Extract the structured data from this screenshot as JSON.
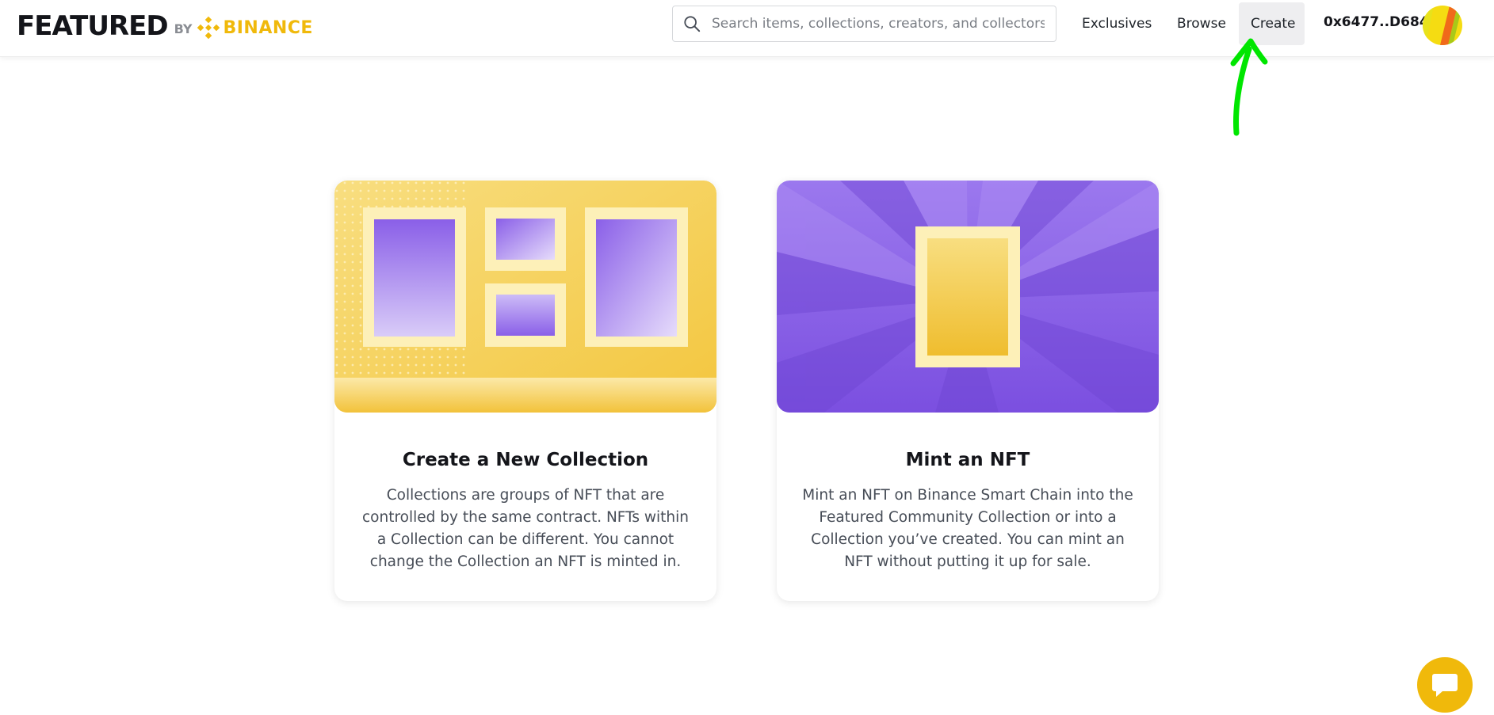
{
  "brand": {
    "name": "FEATURED",
    "by": "BY",
    "partner": "BINANCE",
    "accent_color": "#f0b90b"
  },
  "search": {
    "placeholder": "Search items, collections, creators, and collectors",
    "value": ""
  },
  "nav": {
    "exclusives": "Exclusives",
    "browse": "Browse",
    "create": "Create"
  },
  "account": {
    "wallet": "0x6477..D684",
    "avatar_icon": "wallet-avatar-icon"
  },
  "cards": [
    {
      "title": "Create a New Collection",
      "description": "Collections are groups of NFT that are controlled by the same contract. NFTs within a Collection can be different. You cannot change the Collection an NFT is minted in.",
      "art": "gallery-frames-illustration"
    },
    {
      "title": "Mint an NFT",
      "description": "Mint an NFT on Binance Smart Chain into the Featured Community Collection or into a Collection you’ve created. You can mint an NFT without putting it up for sale.",
      "art": "single-frame-illustration"
    }
  ],
  "chat": {
    "icon": "chat-bubble-icon"
  },
  "annotation": {
    "color": "#00e600",
    "icon": "arrow-up-icon"
  }
}
